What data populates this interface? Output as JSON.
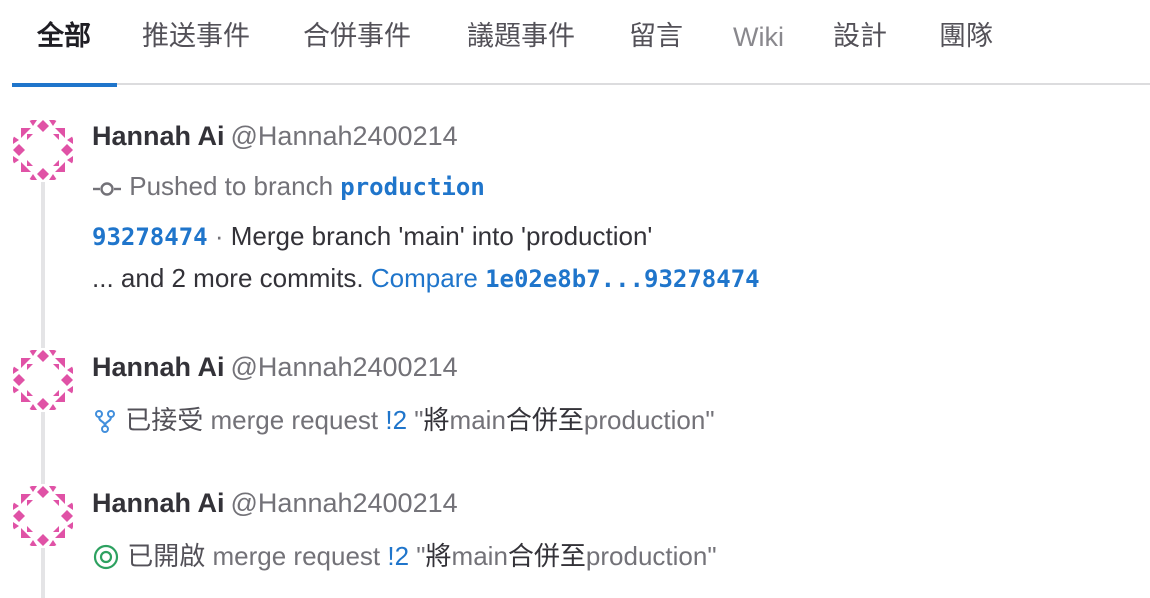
{
  "tabs": [
    {
      "label": "全部",
      "active": true
    },
    {
      "label": "推送事件"
    },
    {
      "label": "合併事件"
    },
    {
      "label": "議題事件"
    },
    {
      "label": "留言"
    },
    {
      "label": "Wiki"
    },
    {
      "label": "設計"
    },
    {
      "label": "團隊"
    }
  ],
  "events": [
    {
      "author": "Hannah Ai",
      "handle": "@Hannah2400214",
      "icon": "commit-icon",
      "action": "Pushed to branch",
      "branch": "production",
      "commit_sha": "93278474",
      "separator": "·",
      "commit_message": "Merge branch 'main' into 'production'",
      "more_prefix": "... and 2 more commits.",
      "compare_label": "Compare",
      "compare_range": "1e02e8b7...93278474"
    },
    {
      "author": "Hannah Ai",
      "handle": "@Hannah2400214",
      "icon": "merge-request-icon",
      "action_cjk": "已接受",
      "target_type": "merge request",
      "ref": "!2",
      "title_open_quote": "\"",
      "title_cjk_1": "將",
      "title_latin_1": "main",
      "title_cjk_2": "合併至",
      "title_latin_2": "production",
      "title_close_quote": "\""
    },
    {
      "author": "Hannah Ai",
      "handle": "@Hannah2400214",
      "icon": "issue-open-icon",
      "action_cjk": "已開啟",
      "target_type": "merge request",
      "ref": "!2",
      "title_open_quote": "\"",
      "title_cjk_1": "將",
      "title_latin_1": "main",
      "title_cjk_2": "合併至",
      "title_latin_2": "production",
      "title_close_quote": "\""
    }
  ],
  "colors": {
    "accent": "#1f75cb",
    "avatar_pink": "#e052a6",
    "open_green": "#2da160",
    "merge_blue": "#428fdc"
  }
}
